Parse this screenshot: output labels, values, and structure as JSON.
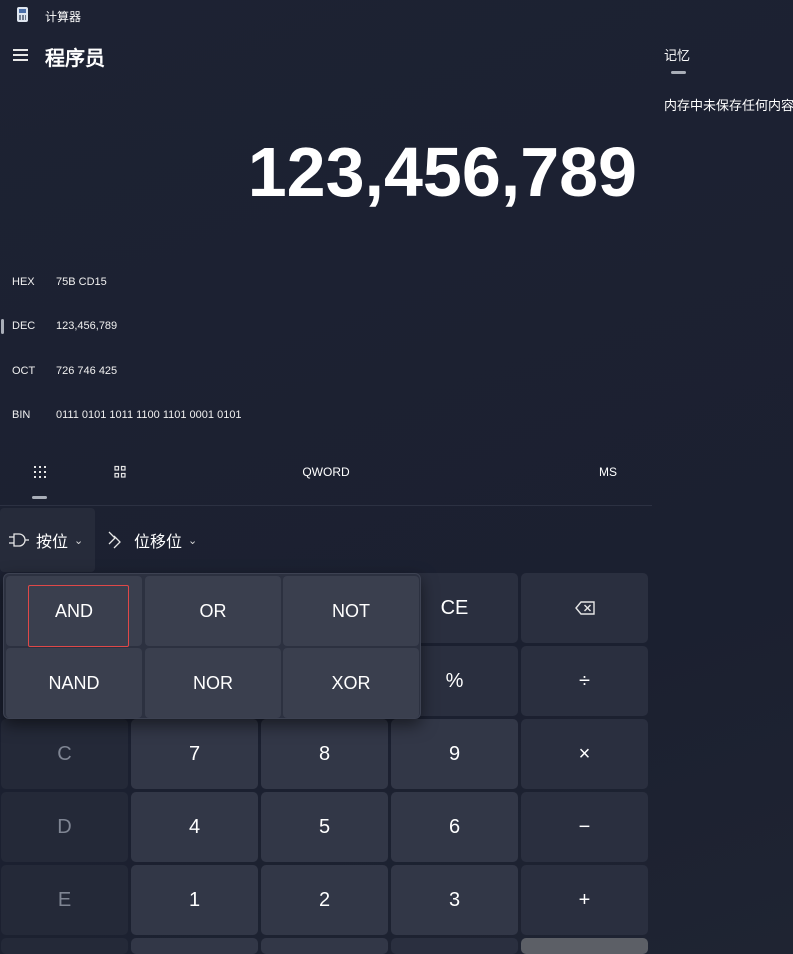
{
  "window": {
    "title": "计算器"
  },
  "header": {
    "mode_title": "程序员"
  },
  "memory": {
    "tab_label": "记忆",
    "empty_message": "内存中未保存任何内容"
  },
  "display": {
    "value": "123,456,789"
  },
  "radix": [
    {
      "name": "HEX",
      "value": "75B CD15"
    },
    {
      "name": "DEC",
      "value": "123,456,789",
      "active": true
    },
    {
      "name": "OCT",
      "value": "726 746 425"
    },
    {
      "name": "BIN",
      "value": "0111 0101 1011 1100 1101 0001 0101"
    }
  ],
  "toolbar": {
    "word_size": "QWORD",
    "memory_store": "MS"
  },
  "dropdowns": {
    "bitwise_label": "按位",
    "bitshift_label": "位移位"
  },
  "flyout": {
    "row1": [
      "AND",
      "OR",
      "NOT"
    ],
    "row2": [
      "NAND",
      "NOR",
      "XOR"
    ]
  },
  "keys": {
    "ce": "CE",
    "percent": "%",
    "c_hex": "C",
    "d_hex": "D",
    "e_hex": "E",
    "seven": "7",
    "eight": "8",
    "nine": "9",
    "four": "4",
    "five": "5",
    "six": "6",
    "one": "1",
    "two": "2",
    "three": "3"
  },
  "icons": {
    "backspace": "backspace-icon",
    "divide": "÷",
    "multiply": "×",
    "minus": "−",
    "plus": "+"
  },
  "colors": {
    "background": "#1c2131",
    "key_number": "#323747",
    "key_operator": "#2a2f3f",
    "focus": "#e04848"
  }
}
